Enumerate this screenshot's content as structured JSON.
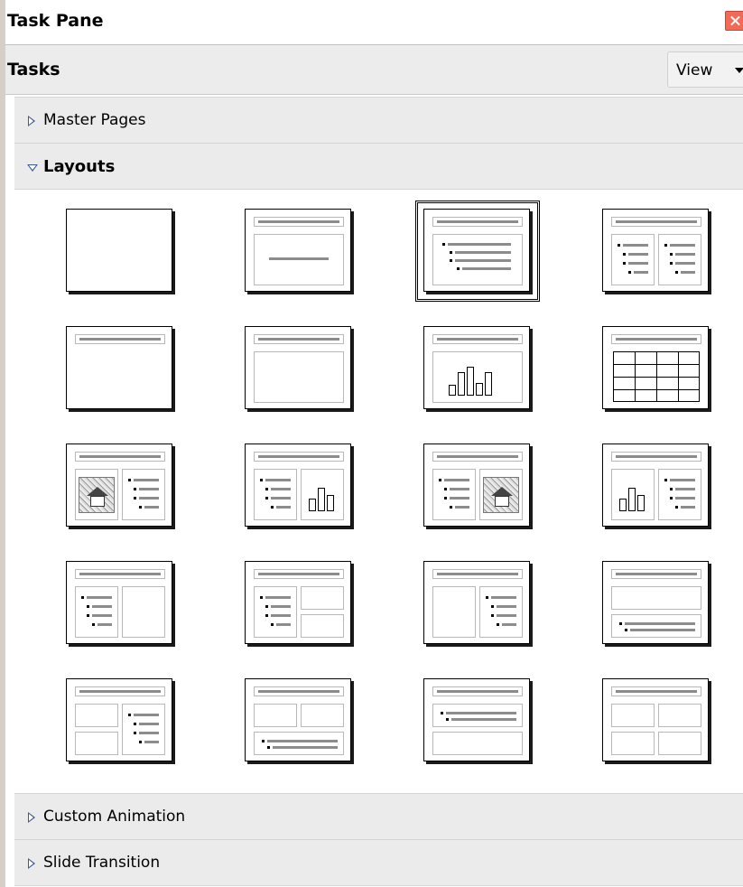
{
  "window": {
    "title": "Task Pane",
    "close_icon": "close-icon"
  },
  "toolbar": {
    "title": "Tasks",
    "view_label": "View"
  },
  "sections": {
    "master_pages": {
      "label": "Master Pages",
      "expanded": false
    },
    "layouts": {
      "label": "Layouts",
      "expanded": true
    },
    "custom_animation": {
      "label": "Custom Animation",
      "expanded": false
    },
    "slide_transition": {
      "label": "Slide Transition",
      "expanded": false
    }
  },
  "layouts": {
    "selected_index": 2,
    "items": [
      "blank-slide",
      "title-slide",
      "title-content",
      "title-2-content",
      "title-only",
      "centered-text",
      "title-chart",
      "title-table",
      "title-clipart-text",
      "title-text-chart",
      "title-text-clipart",
      "title-chart-text",
      "title-text-content",
      "title-text-2-content",
      "title-content-text",
      "title-content-over-text",
      "title-2-content-text",
      "title-2-content-over-text",
      "title-text-over-content",
      "title-4-content"
    ]
  },
  "colors": {
    "section_bg": "#ebebeb",
    "triangle": "#3a5c99",
    "close": "#f26a56"
  }
}
